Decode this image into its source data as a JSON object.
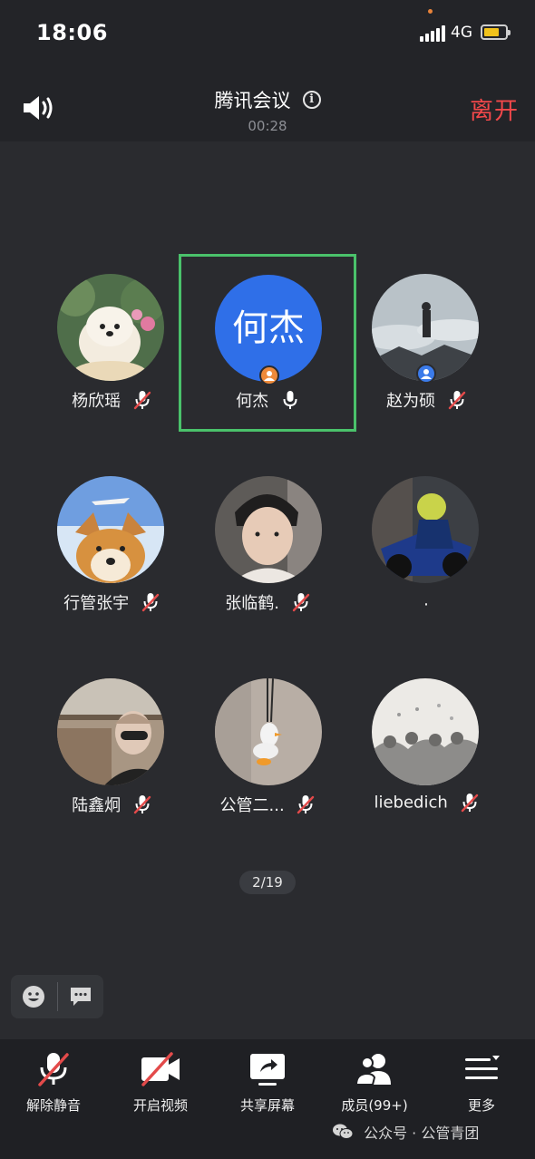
{
  "status_bar": {
    "time": "18:06",
    "network": "4G"
  },
  "header": {
    "title": "腾讯会议",
    "duration": "00:28",
    "leave_label": "离开"
  },
  "participants": [
    {
      "name": "杨欣瑶",
      "muted": true
    },
    {
      "name": "何杰",
      "muted": false,
      "avatar_text": "何杰",
      "active_speaker": true
    },
    {
      "name": "赵为硕",
      "muted": true
    },
    {
      "name": "行管张宇",
      "muted": true
    },
    {
      "name": "张临鹤.",
      "muted": true
    },
    {
      "name": ".",
      "muted": false
    },
    {
      "name": "陆鑫炯",
      "muted": true
    },
    {
      "name": "公管二...",
      "muted": true
    },
    {
      "name": "liebedich",
      "muted": true
    }
  ],
  "pager": {
    "text": "2/19"
  },
  "toolbar": {
    "unmute_label": "解除静音",
    "video_label": "开启视频",
    "share_label": "共享屏幕",
    "members_label": "成员(99+)",
    "more_label": "更多"
  },
  "watermark": {
    "text": "公众号 · 公管青团"
  },
  "colors": {
    "background": "#2a2b2f",
    "header_bg": "#232428",
    "leave_red": "#f2484a",
    "active_border": "#4ac26b",
    "avatar_blue": "#2f6fe8",
    "muted_red": "#e34a4a"
  }
}
